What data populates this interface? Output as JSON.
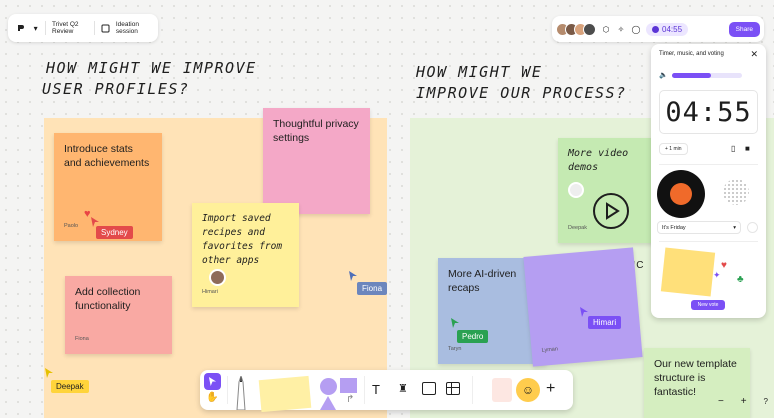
{
  "topbar": {
    "board_title": "Trivet Q2 Review",
    "session_label": "Ideation session"
  },
  "header_right": {
    "timer": "04:55",
    "share_label": "Share"
  },
  "sections": {
    "left_heading_line1": "HOW MIGHT WE IMPROVE",
    "left_heading_line2": "USER PROFILES?",
    "right_heading_line1": "HOW MIGHT WE",
    "right_heading_line2": "IMPROVE OUR PROCESS?"
  },
  "stickies": {
    "stats": {
      "text": "Introduce stats and achievements",
      "author": "Paolo"
    },
    "privacy": {
      "text": "Thoughtful privacy settings"
    },
    "import": {
      "text": "Import saved recipes and favorites from other apps",
      "author": "Himari"
    },
    "collection": {
      "text": "Add collection functionality",
      "author": "Fiona"
    },
    "video": {
      "text": "More video demos",
      "author": "Deepak"
    },
    "ai": {
      "text": "More AI-driven recaps",
      "author": "Taryn"
    },
    "purple": {
      "author": "Lyman"
    },
    "template": {
      "text": "Our new template structure is fantastic!"
    },
    "sync_partial": "NC"
  },
  "cursors": {
    "sydney": "Sydney",
    "fiona": "Fiona",
    "deepak": "Deepak",
    "pedro": "Pedro",
    "himari": "Himari"
  },
  "panel": {
    "title": "Timer, music, and voting",
    "timer": "04:55",
    "add_time": "+ 1 min",
    "playlist": "It's Friday",
    "new_vote_label": "New vote"
  },
  "colors": {
    "accent": "#7b50f5",
    "section_orange": "#ffe3b7",
    "section_green": "#e5f2d8"
  }
}
